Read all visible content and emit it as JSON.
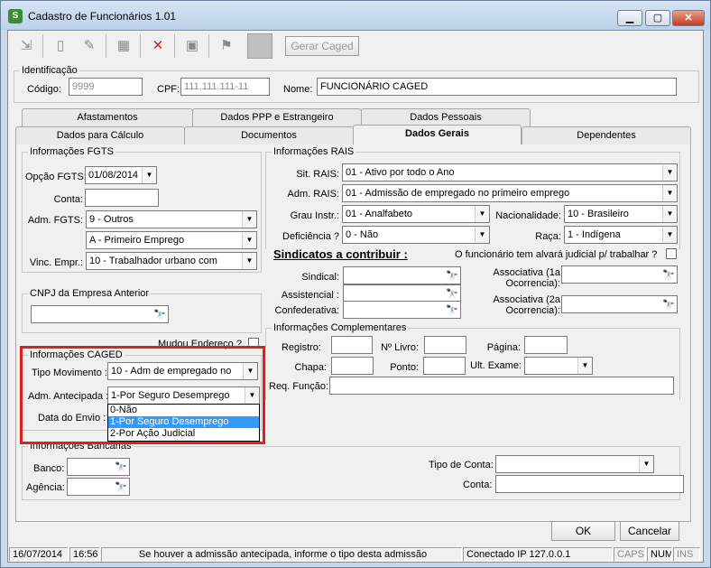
{
  "window": {
    "title": "Cadastro de Funcionários 1.01",
    "min": "▁",
    "max": "▢",
    "close": "✕"
  },
  "toolbar": {
    "btn_gerar_caged": "Gerar Caged"
  },
  "identificacao": {
    "label": "Identificação",
    "codigo_label": "Código:",
    "codigo": "9999",
    "cpf_label": "CPF:",
    "cpf": "111.111.111-11",
    "nome_label": "Nome:",
    "nome": "FUNCIONÁRIO CAGED"
  },
  "tabs_row1": [
    "Afastamentos",
    "Dados PPP e Estrangeiro",
    "Dados Pessoais"
  ],
  "tabs_row2": [
    "Dados para Cálculo",
    "Documentos",
    "Dados Gerais",
    "Dependentes"
  ],
  "fgts": {
    "label": "Informações FGTS",
    "opcao_label": "Opção FGTS:",
    "opcao": "01/08/2014",
    "conta_label": "Conta:",
    "conta": "",
    "adm_label": "Adm. FGTS:",
    "adm": "9 - Outros",
    "adm2": "A - Primeiro Emprego",
    "vinc_label": "Vinc. Empr.:",
    "vinc": "10 - Trabalhador urbano com"
  },
  "cnpj": {
    "label": "CNPJ da Empresa Anterior",
    "value": "",
    "mudou_label": "Mudou Endereço ?"
  },
  "caged": {
    "label": "Informações CAGED",
    "tipo_label": "Tipo Movimento :",
    "tipo": "10 - Adm de empregado no",
    "adm_ant_label": "Adm. Antecipada :",
    "adm_ant": "1-Por Seguro Desemprego",
    "data_envio_label": "Data do Envio :",
    "options": [
      "0-Não",
      "1-Por Seguro Desemprego",
      "2-Por Ação Judicial"
    ]
  },
  "rais": {
    "label": "Informações RAIS",
    "sit_label": "Sit. RAIS:",
    "sit": "01 - Ativo por todo o Ano",
    "adm_label": "Adm. RAIS:",
    "adm": "01 - Admissão de empregado no primeiro emprego",
    "grau_label": "Grau Instr.:",
    "grau": "01 - Analfabeto",
    "nac_label": "Nacionalidade:",
    "nac": "10 - Brasileiro",
    "def_label": "Deficiência ?",
    "def": "0 - Não",
    "raca_label": "Raça:",
    "raca": "1 - Indígena"
  },
  "sindicatos": {
    "heading": "Sindicatos a contribuir :",
    "alvara_label": "O funcionário tem alvará judicial p/ trabalhar ?",
    "sindical_label": "Sindical:",
    "assistencial_label": "Assistencial :",
    "confederativa_label": "Confederativa:",
    "assoc1_label": "Associativa (1a Ocorrencia):",
    "assoc2_label": "Associativa (2a Ocorrencia):"
  },
  "complementares": {
    "label": "Informações Complementares",
    "registro_label": "Registro:",
    "livro_label": "Nº Livro:",
    "pagina_label": "Página:",
    "chapa_label": "Chapa:",
    "ponto_label": "Ponto:",
    "exame_label": "Ult. Exame:",
    "req_label": "Req. Função:"
  },
  "bancarias": {
    "label": "Informações Bancárias",
    "banco_label": "Banco:",
    "agencia_label": "Agência:",
    "tipo_conta_label": "Tipo de Conta:",
    "conta_label": "Conta:"
  },
  "buttons": {
    "ok": "OK",
    "cancelar": "Cancelar"
  },
  "statusbar": {
    "date": "16/07/2014",
    "time": "16:56",
    "message": "Se houver a admissão antecipada, informe o tipo desta admissão",
    "connection": "Conectado IP 127.0.0.1",
    "caps": "CAPS",
    "num": "NUM",
    "ins": "INS"
  },
  "binoc_icon": "binoculars-icon"
}
